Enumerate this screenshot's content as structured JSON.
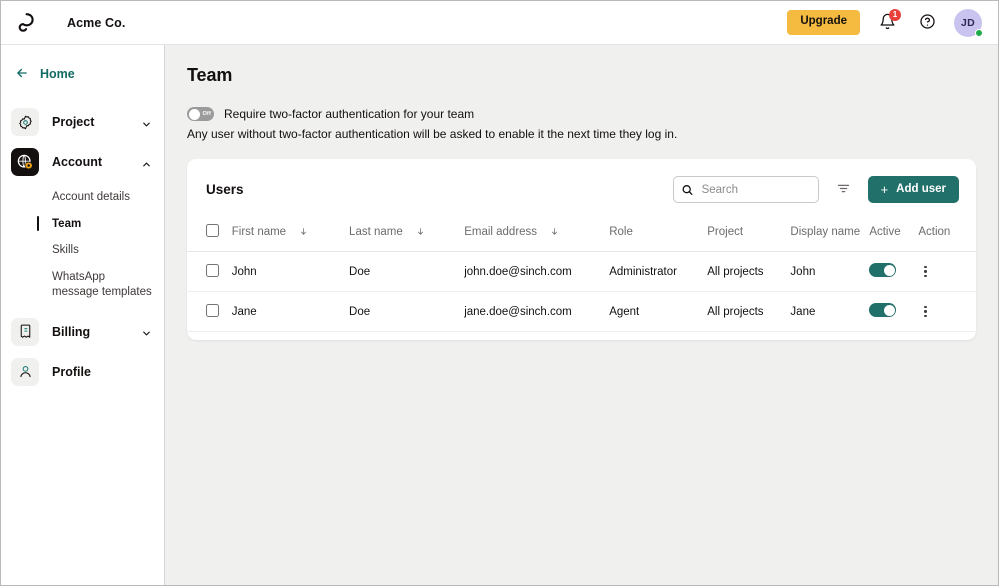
{
  "topbar": {
    "logo_icon": "sinch-swirl-logo",
    "brand_name": "Acme Co.",
    "upgrade_label": "Upgrade",
    "bell_icon": "notification-bell-icon",
    "bell_badge_count": "1",
    "help_icon": "help-circle-icon",
    "avatar_initials": "JD",
    "status_color": "#1faa4b",
    "upgrade_color": "#f5bb41"
  },
  "sidebar": {
    "home_label": "Home",
    "back_icon": "arrow-left-icon",
    "items": [
      {
        "label": "Project",
        "icon": "gear-icon",
        "expanded": false
      },
      {
        "label": "Account",
        "icon": "globe-gear-icon",
        "expanded": true
      },
      {
        "label": "Billing",
        "icon": "invoice-icon",
        "expanded": false
      },
      {
        "label": "Profile",
        "icon": "person-icon",
        "expanded": false
      }
    ],
    "account_subitems": [
      {
        "label": "Account details",
        "active": false
      },
      {
        "label": "Team",
        "active": true
      },
      {
        "label": "Skills",
        "active": false
      },
      {
        "label": "WhatsApp message templates",
        "active": false
      }
    ]
  },
  "main": {
    "page_title": "Team",
    "twofa_toggle_state": "Off",
    "twofa_label": "Require two-factor authentication for your team",
    "twofa_note": "Any user without two-factor authentication will be asked to enable it the next time they log in."
  },
  "card": {
    "title": "Users",
    "search_placeholder": "Search",
    "search_value": "",
    "search_icon": "search-icon",
    "filter_icon": "filter-icon",
    "add_user_label": "Add user",
    "add_user_plus": "+",
    "accent_color": "#22706a"
  },
  "table": {
    "columns": [
      {
        "label": "",
        "sortable": false
      },
      {
        "label": "First name",
        "sortable": true
      },
      {
        "label": "Last name",
        "sortable": true
      },
      {
        "label": "Email address",
        "sortable": true
      },
      {
        "label": "Role",
        "sortable": false
      },
      {
        "label": "Project",
        "sortable": false
      },
      {
        "label": "Display name",
        "sortable": false
      },
      {
        "label": "Active",
        "sortable": false
      },
      {
        "label": "Action",
        "sortable": false
      }
    ],
    "rows": [
      {
        "first_name": "John",
        "last_name": "Doe",
        "email": "john.doe@sinch.com",
        "role": "Administrator",
        "project": "All projects",
        "display_name": "John",
        "active": "on"
      },
      {
        "first_name": "Jane",
        "last_name": "Doe",
        "email": "jane.doe@sinch.com",
        "role": "Agent",
        "project": "All projects",
        "display_name": "Jane",
        "active": "on"
      }
    ]
  }
}
